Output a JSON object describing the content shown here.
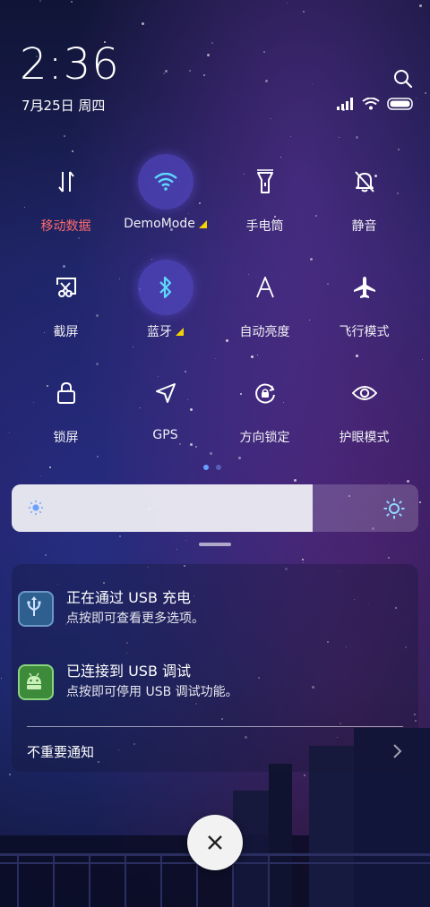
{
  "status": {
    "time": "2:36",
    "date": "7月25日 周四"
  },
  "icons": {
    "search": "search-icon",
    "signal": "signal-icon",
    "wifi": "wifi-icon",
    "battery": "battery-icon"
  },
  "quick_settings": [
    {
      "label": "移动数据",
      "icon": "mobile-data-icon",
      "active": false,
      "alert": true
    },
    {
      "label": "DemoMode",
      "icon": "wifi-icon",
      "active": true,
      "has_more": true
    },
    {
      "label": "手电筒",
      "icon": "flashlight-icon",
      "active": false
    },
    {
      "label": "静音",
      "icon": "mute-bell-icon",
      "active": false
    },
    {
      "label": "截屏",
      "icon": "screenshot-icon",
      "active": false
    },
    {
      "label": "蓝牙",
      "icon": "bluetooth-icon",
      "active": true,
      "has_more": true
    },
    {
      "label": "自动亮度",
      "icon": "auto-brightness-icon",
      "active": false
    },
    {
      "label": "飞行模式",
      "icon": "airplane-icon",
      "active": false
    },
    {
      "label": "锁屏",
      "icon": "lock-icon",
      "active": false
    },
    {
      "label": "GPS",
      "icon": "location-arrow-icon",
      "active": false
    },
    {
      "label": "方向锁定",
      "icon": "rotation-lock-icon",
      "active": false
    },
    {
      "label": "护眼模式",
      "icon": "eye-icon",
      "active": false
    }
  ],
  "page_indicator": {
    "pages": 2,
    "current": 1
  },
  "brightness": {
    "level": 0.74
  },
  "notifications": [
    {
      "title": "正在通过 USB 充电",
      "description": "点按即可查看更多选项。",
      "icon": "usb-icon",
      "icon_color": "#2e5f8f"
    },
    {
      "title": "已连接到 USB 调试",
      "description": "点按即可停用 USB 调试功能。",
      "icon": "android-icon",
      "icon_color": "#3d8a3a"
    }
  ],
  "unimportant_label": "不重要通知",
  "colors": {
    "accent_active": "#5046be",
    "alert_text": "#ff6b6b",
    "triangle": "#f5d300"
  }
}
